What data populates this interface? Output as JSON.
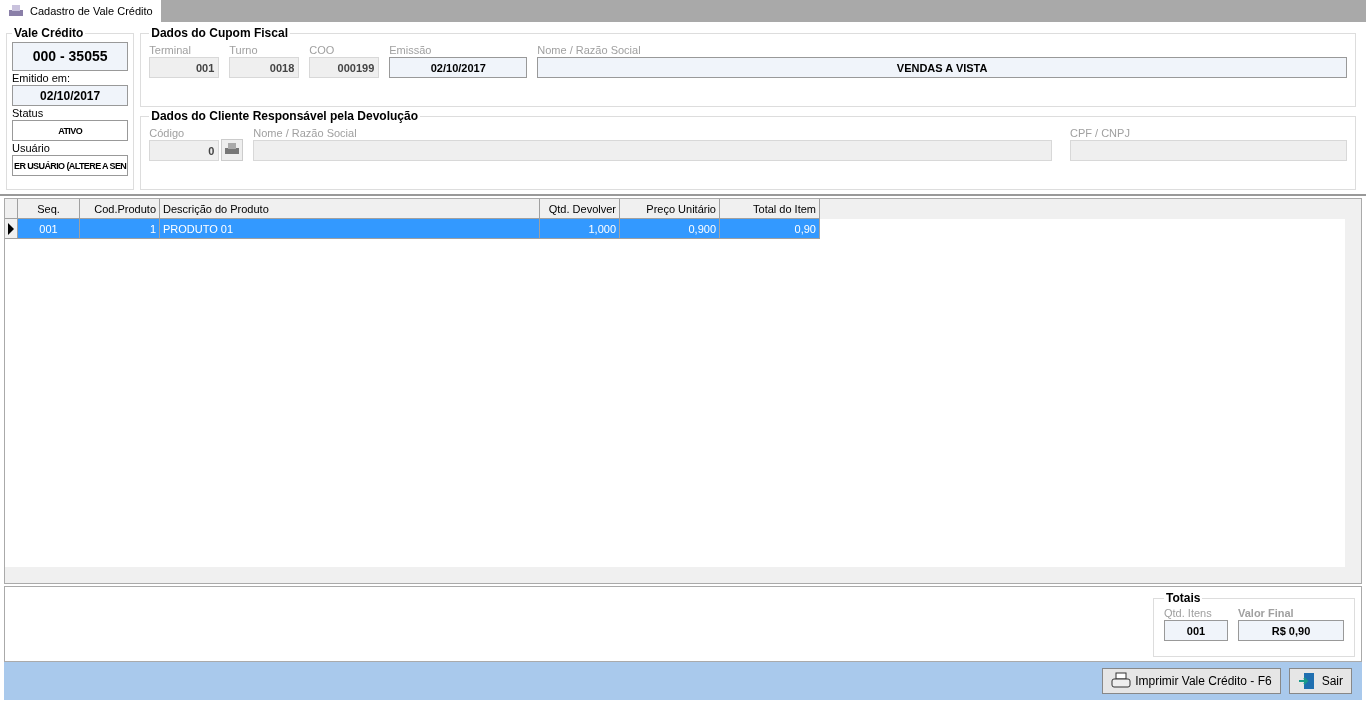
{
  "tab": {
    "title": "Cadastro de Vale Crédito",
    "selected": true
  },
  "vale": {
    "title": "Vale Crédito",
    "number": "000 - 35055",
    "issued_label": "Emitido em:",
    "issued": "02/10/2017",
    "status_label": "Status",
    "status": "ATIVO",
    "user_label": "Usuário",
    "user": "ER USUÁRIO (ALTERE A SEN"
  },
  "cupom": {
    "title": "Dados do Cupom Fiscal",
    "fields": [
      {
        "label": "Terminal",
        "value": "001",
        "disabled": true
      },
      {
        "label": "Turno",
        "value": "0018",
        "disabled": true
      },
      {
        "label": "COO",
        "value": "000199",
        "disabled": true
      },
      {
        "label": "Emissão",
        "value": "02/10/2017",
        "disabled": false
      },
      {
        "label": "Nome / Razão Social",
        "value": "VENDAS A VISTA",
        "disabled": false
      }
    ]
  },
  "cliente": {
    "title": "Dados do Cliente Responsável pela Devolução",
    "code_label": "Código",
    "code": "0",
    "name_label": "Nome / Razão Social",
    "doc_label": "CPF / CNPJ"
  },
  "table": {
    "columns": [
      "Seq.",
      "Cod.Produto",
      "Descrição do Produto",
      "Qtd. Devolver",
      "Preço Unitário",
      "Total do Item"
    ],
    "rows": [
      {
        "selected": true,
        "cells": [
          "001",
          "1",
          "PRODUTO 01",
          "1,000",
          "0,900",
          "0,90"
        ]
      }
    ]
  },
  "totals": {
    "title": "Totais",
    "items_label": "Qtd. Itens",
    "items": "001",
    "final_label": "Valor Final",
    "final": "R$ 0,90"
  },
  "buttons": [
    {
      "kind": "print",
      "label": "Imprimir Vale Crédito - F6"
    },
    {
      "kind": "exit",
      "label": "Sair"
    }
  ]
}
